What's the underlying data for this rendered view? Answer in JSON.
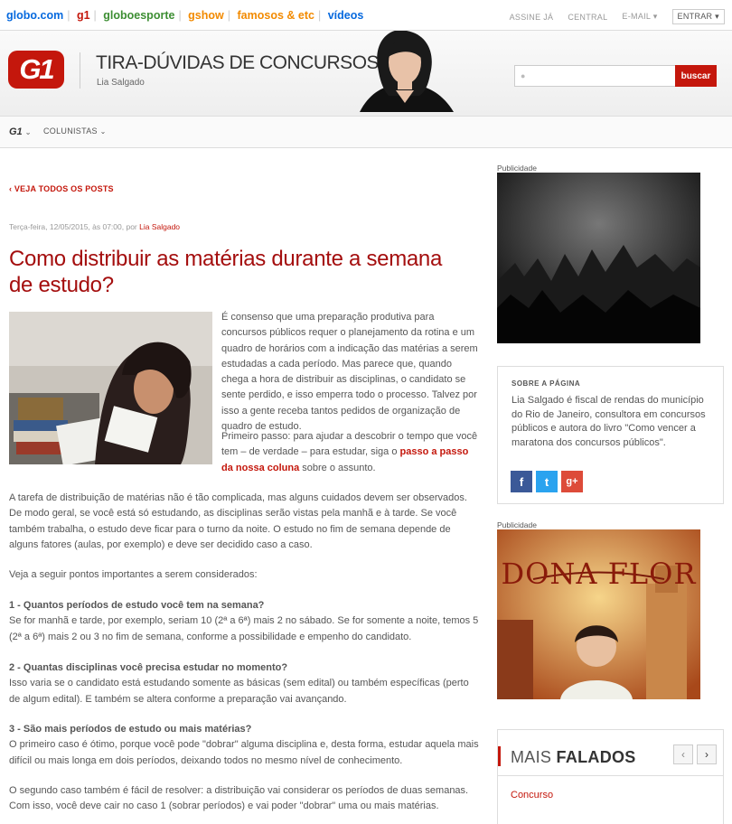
{
  "globalbar": {
    "links": [
      {
        "label": "globo.com",
        "color": "#0669de"
      },
      {
        "label": "g1",
        "color": "#c4170c"
      },
      {
        "label": "globoesporte",
        "color": "#3d8e33"
      },
      {
        "label": "gshow",
        "color": "#f28a00"
      },
      {
        "label": "famosos & etc",
        "color": "#f28a00"
      },
      {
        "label": "vídeos",
        "color": "#0669de"
      }
    ],
    "right": {
      "assine": "ASSINE JÁ",
      "central": "CENTRAL",
      "email": "E-MAIL",
      "entrar": "ENTRAR"
    }
  },
  "header": {
    "logo": "G1",
    "blog_title": "TIRA-DÚVIDAS DE CONCURSOS",
    "author": "Lia Salgado",
    "search_button": "buscar",
    "search_placeholder": ""
  },
  "nav": {
    "g1": "G1",
    "colunistas": "COLUNISTAS"
  },
  "article": {
    "back": "VEJA TODOS OS POSTS",
    "meta_prefix": "Terça-feira, 12/05/2015, às 07:00, por ",
    "meta_author": "Lia Salgado",
    "title": "Como distribuir as matérias durante a semana de estudo?",
    "p1": "É consenso que uma preparação produtiva para concursos públicos requer o planejamento da rotina e um quadro de horários com a indicação das matérias a serem estudadas a cada período. Mas parece que, quando chega a hora de distribuir as disciplinas, o candidato se sente perdido, e isso emperra todo o processo. Talvez por isso a gente receba tantos pedidos de organização de quadro de estudo.",
    "p2_a": "Primeiro passo: para ajudar a descobrir o tempo que você tem – de verdade – para estudar, siga o ",
    "p2_link": "passo a passo da nossa coluna",
    "p2_b": " sobre o assunto.",
    "p3": "A tarefa de distribuição de matérias não é tão complicada, mas alguns cuidados devem ser observados. De modo geral, se você está só estudando, as disciplinas serão vistas pela manhã e à tarde. Se você também trabalha, o estudo deve ficar para o turno da noite. O estudo no fim de semana depende de alguns fatores (aulas, por exemplo) e deve ser decidido caso a caso.",
    "p4": "Veja a seguir pontos importantes a serem considerados:",
    "h1": "1 - Quantos períodos de estudo você tem na semana?",
    "p5": "Se for manhã e tarde, por exemplo, seriam 10 (2ª a 6ª) mais 2 no sábado. Se for somente a noite, temos 5 (2ª a 6ª) mais 2 ou 3 no fim de semana, conforme a possibilidade e empenho do candidato.",
    "h2": "2 - Quantas disciplinas você precisa estudar no momento?",
    "p6": "Isso varia se o candidato está estudando somente as básicas (sem edital) ou também específicas (perto de algum edital). E também se altera conforme a preparação vai avançando.",
    "h3": "3 - São mais períodos de estudo ou mais matérias?",
    "p7": "O primeiro caso é ótimo, porque você pode \"dobrar\" alguma disciplina e, desta forma, estudar aquela mais difícil ou mais longa em dois períodos, deixando todos no mesmo  nível de conhecimento.",
    "p8": "O segundo caso também é fácil de resolver: a distribuição vai considerar os períodos de duas semanas. Com isso, você deve cair no caso 1 (sobrar períodos) e vai poder \"dobrar\" uma ou mais matérias."
  },
  "sidebar": {
    "pub1": "Publicidade",
    "about_title": "SOBRE A PÁGINA",
    "about_text": "Lia Salgado é fiscal de rendas do município do Rio de Janeiro, consultora em concursos públicos e autora do livro \"Como vencer a maratona dos concursos públicos\".",
    "pub2": "Publicidade",
    "ad2_text": "DONA FLOR",
    "mais_a": "MAIS ",
    "mais_b": "FALADOS",
    "mais_item": "Concurso"
  },
  "colors": {
    "brand": "#c4170c",
    "title": "#a40e0e",
    "facebook": "#3b5998",
    "twitter": "#2aa3ef",
    "gplus": "#dd4b39"
  }
}
